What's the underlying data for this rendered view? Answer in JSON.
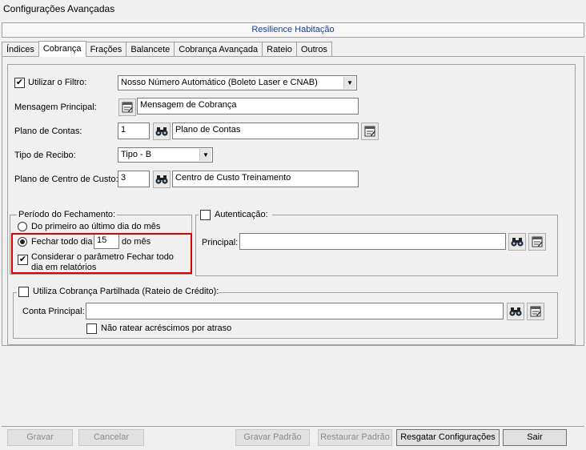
{
  "window": {
    "title": "Configurações Avançadas"
  },
  "banner": {
    "text": "Resilience Habitação"
  },
  "tabs": [
    {
      "label": "Índices"
    },
    {
      "label": "Cobrança"
    },
    {
      "label": "Frações"
    },
    {
      "label": "Balancete"
    },
    {
      "label": "Cobrança Avançada"
    },
    {
      "label": "Rateio"
    },
    {
      "label": "Outros"
    }
  ],
  "form": {
    "filtro": {
      "label": "Utilizar o Filtro:",
      "checked": true,
      "value": "Nosso Número Automático (Boleto Laser e CNAB)"
    },
    "mensagem": {
      "label": "Mensagem Principal:",
      "value": "Mensagem de Cobrança"
    },
    "plano_contas": {
      "label": "Plano de Contas:",
      "code": "1",
      "value": "Plano de Contas"
    },
    "tipo_recibo": {
      "label": "Tipo de Recibo:",
      "value": "Tipo - B"
    },
    "centro_custo": {
      "label": "Plano de Centro de Custo:",
      "code": "3",
      "value": "Centro de Custo Treinamento"
    }
  },
  "periodo": {
    "legend": "Período do Fechamento:",
    "option1": "Do primeiro ao último dia do mês",
    "option2_prefix": "Fechar todo dia",
    "option2_day": "15",
    "option2_suffix": "do mês",
    "considerar_line1": "Considerar o parâmetro Fechar todo",
    "considerar_line2": "dia em relatórios"
  },
  "autenticacao": {
    "legend": "Autenticação:",
    "principal_label": "Principal:",
    "principal_value": ""
  },
  "partilhada": {
    "legend": "Utiliza Cobrança Partilhada (Rateio de Crédito):",
    "conta_label": "Conta Principal:",
    "conta_value": "",
    "nao_ratear": "Não ratear acréscimos por atraso"
  },
  "buttons": {
    "gravar": "Gravar",
    "cancelar": "Cancelar",
    "gravar_padrao": "Gravar Padrão",
    "restaurar_padrao": "Restaurar Padrão",
    "resgatar": "Resgatar Configurações",
    "sair": "Sair"
  }
}
